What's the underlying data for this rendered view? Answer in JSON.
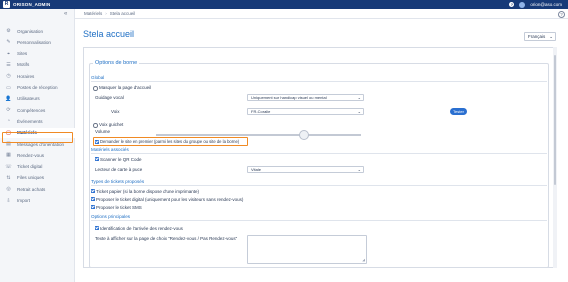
{
  "topbar": {
    "logo_letter": "R",
    "brand": "ORISON_ADMIN",
    "help_icon": "?",
    "user": "orion@aso.com"
  },
  "sidebar": {
    "collapse_icon": "«",
    "items": [
      {
        "label": "Organisation",
        "icon": "gear-icon",
        "glyph": "⚙"
      },
      {
        "label": "Personnalisation",
        "icon": "brush-icon",
        "glyph": "✎"
      },
      {
        "label": "Sites",
        "icon": "pin-icon",
        "glyph": "⌖"
      },
      {
        "label": "Motifs",
        "icon": "list-icon",
        "glyph": "☰"
      },
      {
        "label": "Horaires",
        "icon": "clock-icon",
        "glyph": "◷"
      },
      {
        "label": "Postes de réception",
        "icon": "desk-icon",
        "glyph": "▭"
      },
      {
        "label": "Utilisateurs",
        "icon": "user-icon",
        "glyph": "👤"
      },
      {
        "label": "Compétences",
        "icon": "skills-icon",
        "glyph": "⟳"
      },
      {
        "label": "Événements",
        "icon": "event-icon",
        "glyph": "◔"
      },
      {
        "label": "Matériels",
        "icon": "device-icon",
        "glyph": "▢"
      },
      {
        "label": "Messages d'orientation",
        "icon": "message-icon",
        "glyph": "▤"
      },
      {
        "label": "Rendez-vous",
        "icon": "calendar-icon",
        "glyph": "▦"
      },
      {
        "label": "Ticket digital",
        "icon": "phone-icon",
        "glyph": "☏"
      },
      {
        "label": "Files uniques",
        "icon": "queue-icon",
        "glyph": "⇅"
      },
      {
        "label": "Retrait achats",
        "icon": "cart-icon",
        "glyph": "◎"
      },
      {
        "label": "Import",
        "icon": "import-icon",
        "glyph": "⇩"
      }
    ],
    "active_index": 9
  },
  "breadcrumb": {
    "items": [
      "Matériels",
      "Stela accueil"
    ],
    "separator": "›"
  },
  "page": {
    "title": "Stela accueil",
    "language": "Français",
    "help": "?"
  },
  "form": {
    "legend": "Options de borne",
    "section_general": "Global",
    "hide_home_label": "Masquer la page d'accueil",
    "voice_guidance_label": "Guidage vocal",
    "voice_guidance_value": "Uniquement sur handicap visuel ou mental",
    "voice_label": "Voix",
    "voice_value": "FR-Coralie",
    "test_button": "Tester",
    "voice_guided_label": "Voix guichet",
    "volume_label": "Volume",
    "volume_level": 0.72,
    "ask_site_label": "Demander le site en premier (parmi les sites du groupe ou site de la borne)",
    "section_devices": "Matériels associés",
    "scan_qr_label": "Scanner le QR Code",
    "card_reader_label": "Lecteur de carte à puce",
    "card_reader_value": "Vitale",
    "section_tickets": "Types de tickets proposés",
    "ticket_paper_label": "Ticket papier (si la borne dispose d'une imprimante)",
    "ticket_digital_label": "Proposer le ticket digital (uniquement pour les visiteurs sans rendez-vous)",
    "ticket_sms_label": "Proposer le ticket SMS",
    "section_main": "Options principales",
    "identify_label": "Identification de l'arrivée des rendez-vous",
    "text_display_label": "Texte à afficher sur la page de choix \"Rendez-vous / Pas Rendez-vous\"",
    "text_display_value": ""
  },
  "colors": {
    "accent": "#1f6fc4",
    "topbar": "#173a78",
    "highlight": "#f08a24",
    "button": "#2a6fd0"
  }
}
